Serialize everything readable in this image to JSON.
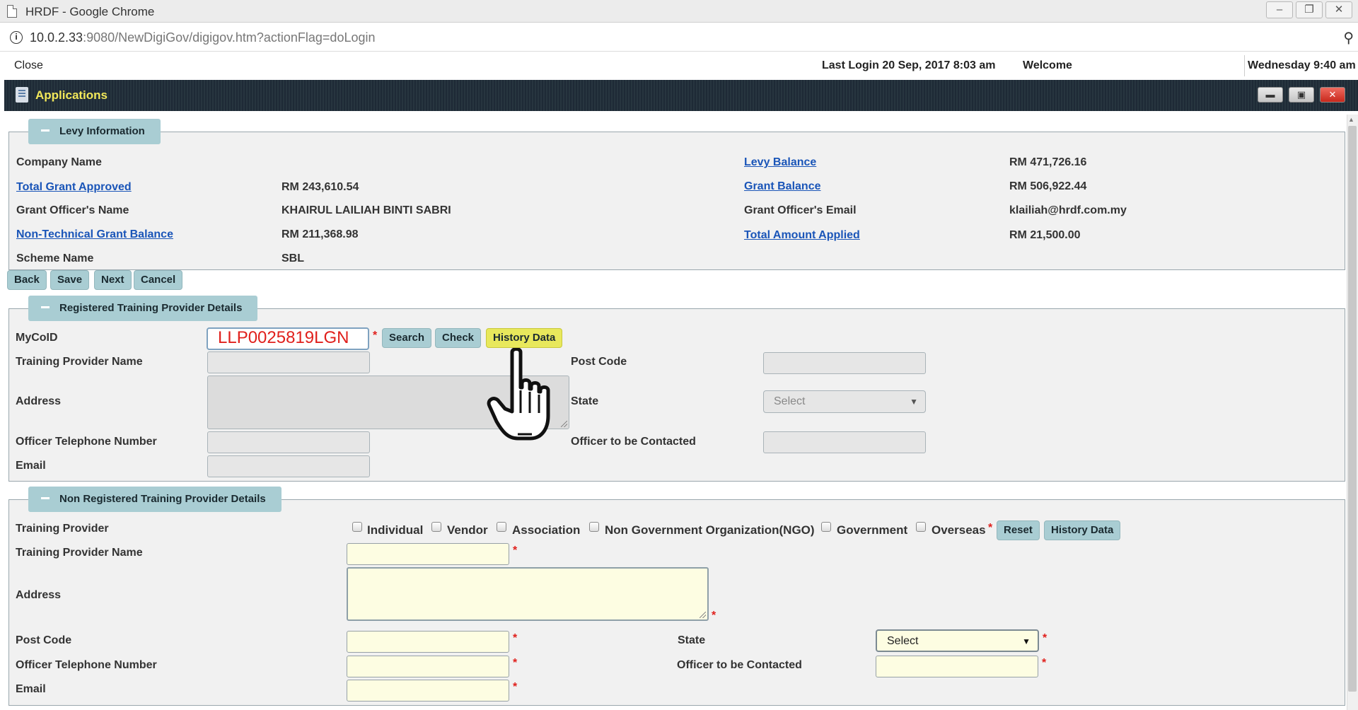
{
  "window": {
    "title": "HRDF - Google Chrome",
    "controls": [
      "–",
      "❐",
      "✕"
    ]
  },
  "browser": {
    "url_host": "10.0.2.33",
    "url_path": ":9080/NewDigiGov/digigov.htm?actionFlag=doLogin"
  },
  "appbar": {
    "close": "Close",
    "last_login": "Last Login 20 Sep, 2017 8:03 am",
    "welcome": "Welcome",
    "datetime": "Wednesday 9:40 am"
  },
  "apps_header": {
    "title": "Applications"
  },
  "levy": {
    "legend": "Levy Information",
    "company_name_label": "Company Name",
    "total_grant_approved_label": "Total Grant Approved",
    "total_grant_approved_value": "RM 243,610.54",
    "grant_officer_name_label": "Grant Officer's Name",
    "grant_officer_name_value": "KHAIRUL LAILIAH BINTI SABRI",
    "non_technical_label": "Non-Technical Grant Balance",
    "non_technical_value": "RM 211,368.98",
    "scheme_name_label": "Scheme Name",
    "scheme_name_value": "SBL",
    "levy_balance_label": "Levy Balance",
    "levy_balance_value": "RM 471,726.16",
    "grant_balance_label": "Grant Balance",
    "grant_balance_value": "RM 506,922.44",
    "grant_officer_email_label": "Grant Officer's Email",
    "grant_officer_email_value": "klailiah@hrdf.com.my",
    "total_amount_applied_label": "Total Amount Applied",
    "total_amount_applied_value": "RM 21,500.00"
  },
  "nav_buttons": {
    "back": "Back",
    "save": "Save",
    "next": "Next",
    "cancel": "Cancel"
  },
  "registered": {
    "legend": "Registered Training Provider Details",
    "mycoid_label": "MyCoID",
    "mycoid_value": "LLP0025819LGN",
    "search": "Search",
    "check": "Check",
    "history": "History Data",
    "provider_name_label": "Training Provider Name",
    "address_label": "Address",
    "officer_phone_label": "Officer Telephone Number",
    "email_label": "Email",
    "post_code_label": "Post Code",
    "state_label": "State",
    "state_value": "Select",
    "officer_contact_label": "Officer to be Contacted"
  },
  "non_registered": {
    "legend": "Non Registered Training Provider Details",
    "provider_label": "Training Provider",
    "options": [
      "Individual",
      "Vendor",
      "Association",
      "Non Government Organization(NGO)",
      "Government",
      "Overseas"
    ],
    "reset": "Reset",
    "history": "History Data",
    "provider_name_label": "Training Provider Name",
    "address_label": "Address",
    "post_code_label": "Post Code",
    "officer_phone_label": "Officer Telephone Number",
    "email_label": "Email",
    "state_label": "State",
    "state_value": "Select",
    "officer_contact_label": "Officer to be Contacted"
  },
  "required_mark": "*",
  "icons": [
    "document-icon",
    "info-icon",
    "key-icon",
    "applications-icon",
    "pointer-hand-cursor"
  ]
}
